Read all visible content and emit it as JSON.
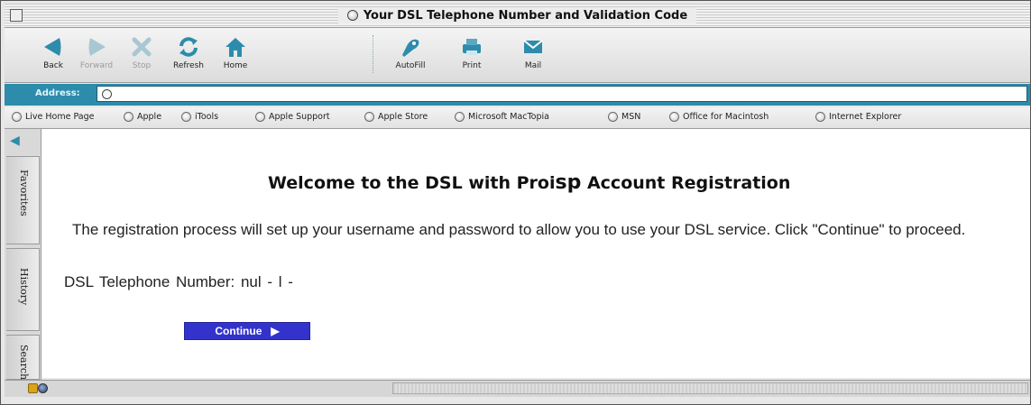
{
  "window": {
    "title": "Your DSL Telephone Number and Validation Code"
  },
  "toolbar": {
    "buttons": [
      {
        "label": "Back",
        "icon": "back-arrow-icon",
        "enabled": true
      },
      {
        "label": "Forward",
        "icon": "forward-arrow-icon",
        "enabled": false
      },
      {
        "label": "Stop",
        "icon": "stop-x-icon",
        "enabled": false
      },
      {
        "label": "Refresh",
        "icon": "refresh-icon",
        "enabled": true
      },
      {
        "label": "Home",
        "icon": "home-icon",
        "enabled": true
      },
      {
        "label": "AutoFill",
        "icon": "autofill-icon",
        "enabled": true
      },
      {
        "label": "Print",
        "icon": "printer-icon",
        "enabled": true
      },
      {
        "label": "Mail",
        "icon": "mail-icon",
        "enabled": true
      }
    ]
  },
  "address": {
    "label": "Address:",
    "value": ""
  },
  "favorites": [
    "Live Home Page",
    "Apple",
    "iTools",
    "Apple Support",
    "Apple Store",
    "Microsoft MacTopia",
    "MSN",
    "Office for Macintosh",
    "Internet Explorer"
  ],
  "sidebar": {
    "tabs": [
      "Favorites",
      "History",
      "Search"
    ]
  },
  "page": {
    "heading_prefix": "Welcome to the DSL with ",
    "heading_brand_a": "Proi",
    "heading_brand_b": "sp",
    "heading_suffix": " Account Registration",
    "intro": "The registration process will set up your username and password to allow you to use your DSL service. Click \"Continue\" to proceed.",
    "dsl_label": "DSL Telephone Number:",
    "dsl_value": "nul - l -",
    "continue_label": "Continue"
  },
  "colors": {
    "accent": "#2d8cab",
    "continue_button": "#3333cc",
    "toolbar_icon": "#2d8cab"
  }
}
